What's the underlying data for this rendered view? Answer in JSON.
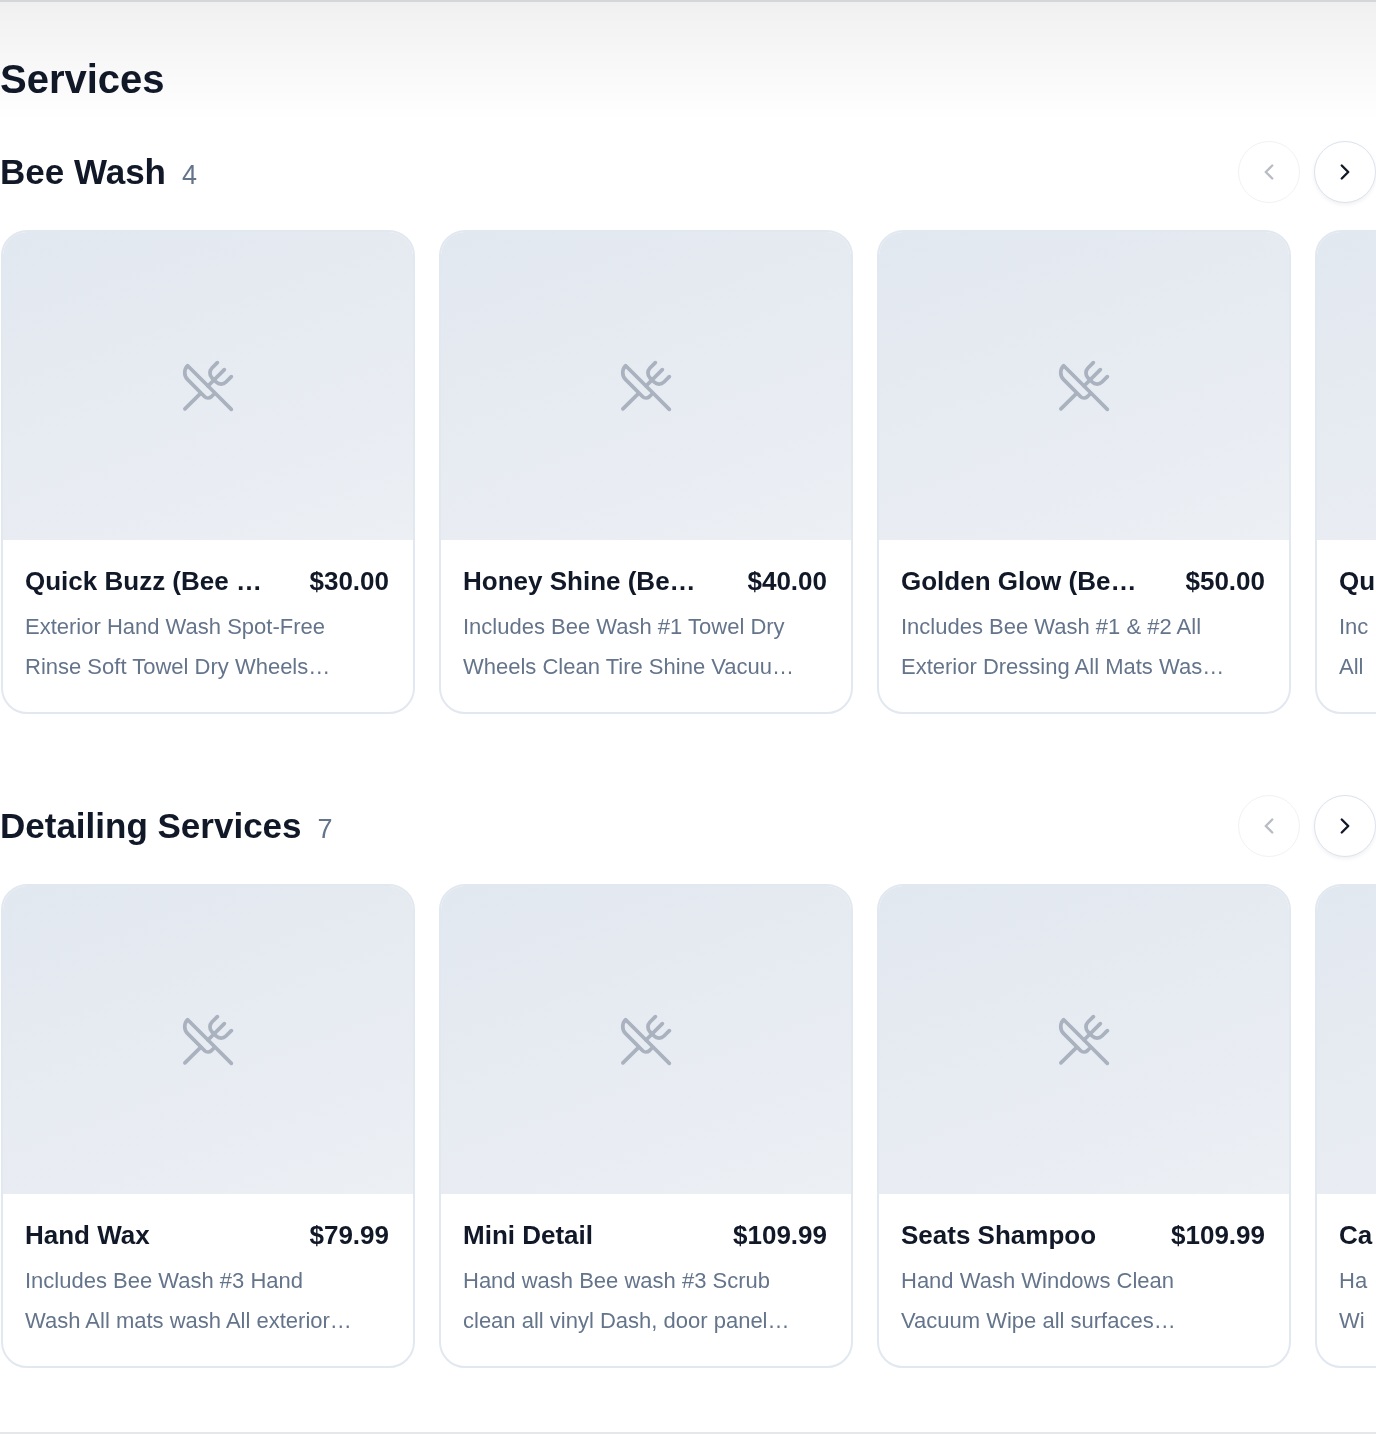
{
  "page_title": "Services",
  "sections": [
    {
      "title": "Bee Wash",
      "count": "4",
      "prev": {
        "disabled": true
      },
      "next": {
        "disabled": false
      },
      "cards": [
        {
          "title": "Quick Buzz (Bee …",
          "price": "$30.00",
          "description_lines": [
            "Exterior Hand Wash Spot-Free",
            "Rinse Soft Towel Dry Wheels…"
          ]
        },
        {
          "title": "Honey Shine (Be…",
          "price": "$40.00",
          "description_lines": [
            "Includes Bee Wash #1 Towel Dry",
            "Wheels Clean Tire Shine Vacuu…"
          ]
        },
        {
          "title": "Golden Glow (Be…",
          "price": "$50.00",
          "description_lines": [
            "Includes Bee Wash #1 & #2 All",
            "Exterior Dressing All Mats Was…"
          ]
        },
        {
          "title": "Qu",
          "description_lines": [
            "Inc",
            "All"
          ]
        }
      ]
    },
    {
      "title": "Detailing Services",
      "count": "7",
      "prev": {
        "disabled": true
      },
      "next": {
        "disabled": false
      },
      "cards": [
        {
          "title": "Hand Wax",
          "price": "$79.99",
          "description_lines": [
            "Includes Bee Wash #3 Hand",
            "Wash All mats wash All exterior…"
          ]
        },
        {
          "title": "Mini Detail",
          "price": "$109.99",
          "description_lines": [
            "Hand wash Bee wash #3 Scrub",
            "clean all vinyl Dash, door panel…"
          ]
        },
        {
          "title": "Seats Shampoo",
          "price": "$109.99",
          "description_lines": [
            "Hand Wash Windows Clean",
            "Vacuum Wipe all surfaces…"
          ]
        },
        {
          "title": "Ca",
          "description_lines": [
            "Ha",
            "Wi"
          ]
        }
      ]
    }
  ]
}
